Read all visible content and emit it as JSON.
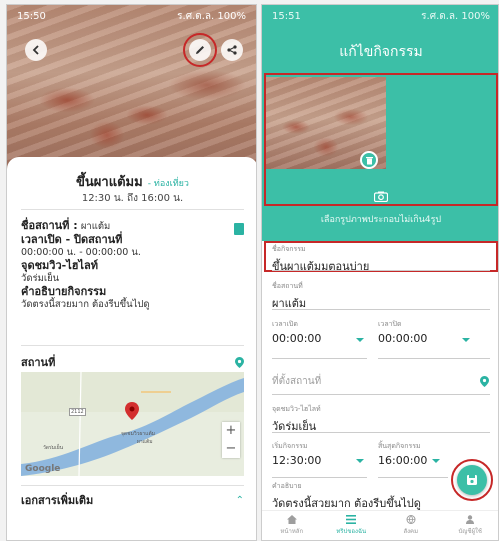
{
  "left": {
    "status": {
      "time": "15:50",
      "right": "ร.ศ.ด.ล. 100%"
    },
    "title": "ขึ้นผาแต้มม",
    "tag": "- ท่องเที่ยว",
    "time_range": "12:30 น. ถึง 16:00 น.",
    "place_label": "ชื่อสถานที่ :",
    "place_value": "ผาแต้ม",
    "hours_label": "เวลาเปิด - ปิดสถานที่",
    "hours_value": "00:00:00 น. - 00:00:00 น.",
    "viewpoint_label": "จุดชมวิว-ไฮไลท์",
    "viewpoint_value": "วัดร่มเย็น",
    "desc_label": "คำอธิบายกิจกรรม",
    "desc_value": "วัดตรงนี้สวยมาก ต้องรีบขึ้นไปดู",
    "location_label": "สถานที่",
    "map": {
      "labels": [
        "จุดชมวิวผาแต้ม",
        "ผาแต้ม",
        "วัดร่มเย็น"
      ],
      "route": "2112",
      "attribution": "Google",
      "zoom_in": "+",
      "zoom_out": "−"
    },
    "more_docs_label": "เอกสารเพิ่มเติม"
  },
  "right": {
    "status": {
      "time": "15:51",
      "right": "ร.ศ.ด.ล. 100%"
    },
    "header_title": "แก้ไขกิจกรรม",
    "photo_hint": "เลือกรูปภาพประกอบไม่เกิน4รูป",
    "fields": {
      "activity_name": {
        "label": "ชื่อกิจกรรม",
        "value": "ขึ้นผาแต้มมตอนบ่าย"
      },
      "place_name": {
        "label": "ชื่อสถานที่",
        "value": "ผาแต้ม"
      },
      "open_time": {
        "label": "เวลาเปิด",
        "value": "00:00:00"
      },
      "close_time": {
        "label": "เวลาปิด",
        "value": "00:00:00"
      },
      "location": {
        "placeholder": "ที่ตั้งสถานที่"
      },
      "viewpoint": {
        "label": "จุดชมวิว-ไฮไลท์",
        "value": "วัดร่มเย็น"
      },
      "start": {
        "label": "เริ่มกิจกรรม",
        "value": "12:30:00"
      },
      "end": {
        "label": "สิ้นสุดกิจกรรม",
        "value": "16:00:00"
      },
      "description": {
        "label": "คำอธิบาย",
        "value": "วัดตรงนี้สวยมาก ต้องรีบขึ้นไปดู"
      }
    },
    "nav": [
      {
        "label": "หน้าหลัก",
        "icon": "home-icon"
      },
      {
        "label": "ทริปของฉัน",
        "icon": "list-icon"
      },
      {
        "label": "สังคม",
        "icon": "globe-icon"
      },
      {
        "label": "บัญชีผู้ใช้",
        "icon": "person-icon"
      }
    ]
  },
  "colors": {
    "accent": "#3cbfa7",
    "highlight": "#c62828"
  }
}
